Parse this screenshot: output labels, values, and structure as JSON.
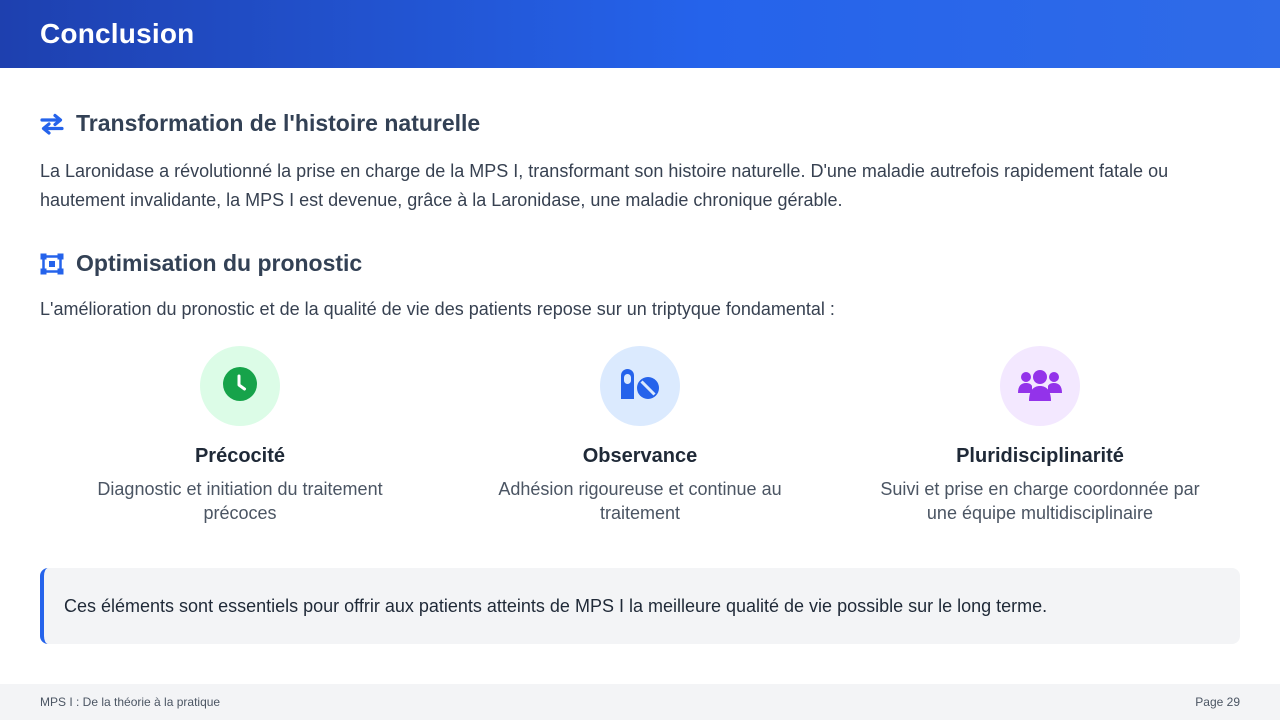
{
  "header": {
    "title": "Conclusion"
  },
  "sections": [
    {
      "icon": "swap-arrows-icon",
      "title": "Transformation de l'histoire naturelle",
      "text": "La Laronidase a révolutionné la prise en charge de la MPS I, transformant son histoire naturelle. D'une maladie autrefois rapidement fatale ou hautement invalidante, la MPS I est devenue, grâce à la Laronidase, une maladie chronique gérable."
    },
    {
      "icon": "object-ungroup-icon",
      "title": "Optimisation du pronostic",
      "text": "L'amélioration du pronostic et de la qualité de vie des patients repose sur un triptyque fondamental :"
    }
  ],
  "pillars": [
    {
      "icon": "clock-icon",
      "title": "Précocité",
      "description": "Diagnostic et initiation du traitement précoces",
      "icon_color": "#16a34a",
      "bg_color": "#dcfce7"
    },
    {
      "icon": "pills-icon",
      "title": "Observance",
      "description": "Adhésion rigoureuse et continue au traitement",
      "icon_color": "#2563eb",
      "bg_color": "#dbeafe"
    },
    {
      "icon": "users-icon",
      "title": "Pluridisciplinarité",
      "description": "Suivi et prise en charge coordonnée par une équipe multidisciplinaire",
      "icon_color": "#9333ea",
      "bg_color": "#f3e8ff"
    }
  ],
  "callout": {
    "text": "Ces éléments sont essentiels pour offrir aux patients atteints de MPS I la meilleure qualité de vie possible sur le long terme."
  },
  "footer": {
    "left": "MPS I : De la théorie à la pratique",
    "right": "Page 29"
  },
  "colors": {
    "accent": "#2563eb",
    "header_start": "#1e40af",
    "header_end": "#2563eb"
  }
}
